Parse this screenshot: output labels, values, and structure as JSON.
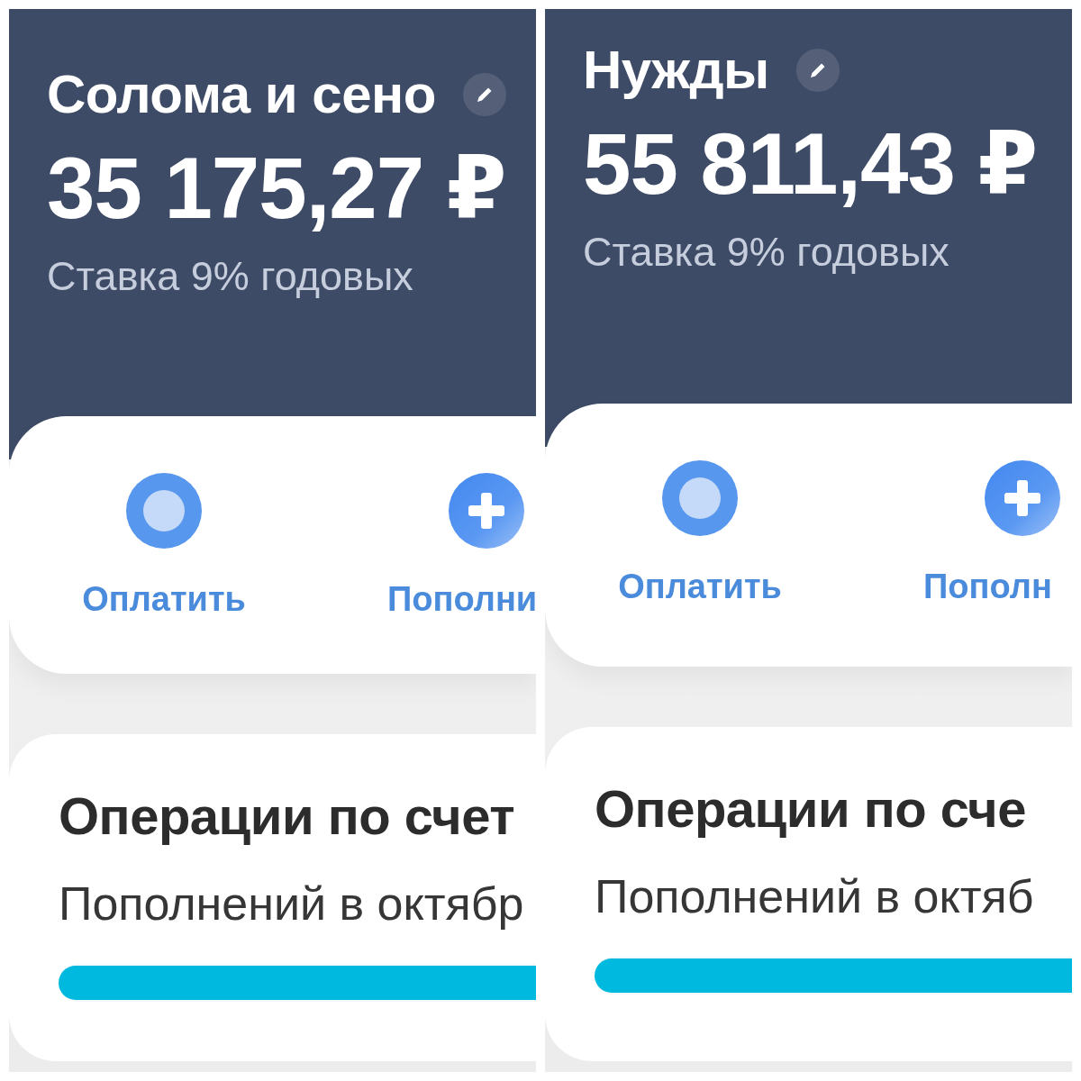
{
  "panels": [
    {
      "account": {
        "title": "Солома и сено",
        "balance": "35 175,27 ₽",
        "rate": "Ставка 9% годовых"
      },
      "actions": [
        {
          "kind": "pay",
          "label": "Оплатить"
        },
        {
          "kind": "deposit",
          "label": "Пополни"
        }
      ],
      "operations": {
        "title": "Операции по счет",
        "subtitle": "Пополнений в октябр",
        "progress": {
          "level": 1
        }
      }
    },
    {
      "account": {
        "title": "Нужды",
        "balance": "55 811,43 ₽",
        "rate": "Ставка 9% годовых"
      },
      "actions": [
        {
          "kind": "pay",
          "label": "Оплатить"
        },
        {
          "kind": "deposit",
          "label": "Пополн"
        }
      ],
      "operations": {
        "title": "Операции по сче",
        "subtitle": "Пополнений в октяб",
        "progress": {
          "level": 1
        }
      }
    }
  ]
}
